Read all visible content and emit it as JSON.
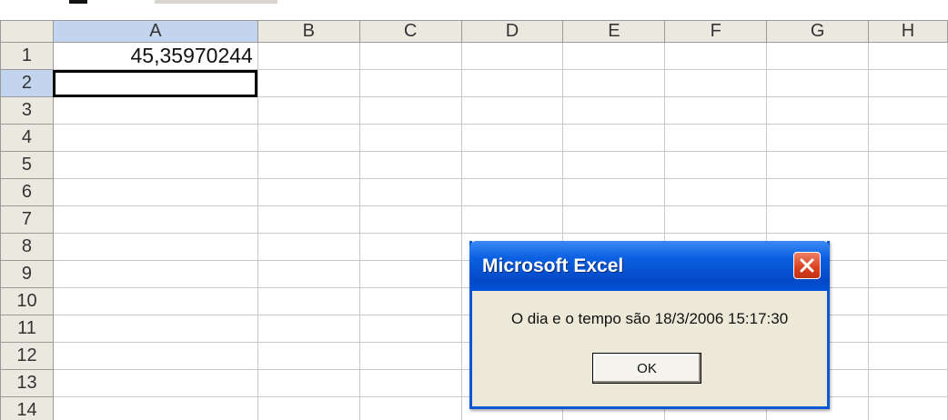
{
  "app": {
    "name": "Microsoft Excel"
  },
  "columns": [
    "A",
    "B",
    "C",
    "D",
    "E",
    "F",
    "G",
    "H"
  ],
  "rows": [
    "1",
    "2",
    "3",
    "4",
    "5",
    "6",
    "7",
    "8",
    "9",
    "10",
    "11",
    "12",
    "13",
    "14"
  ],
  "cells": {
    "A1": "45,35970244"
  },
  "selection": {
    "column": "A",
    "row": "2",
    "active_cell": "A2"
  },
  "dialog": {
    "title": "Microsoft Excel",
    "message": "O dia e o tempo são 18/3/2006 15:17:30",
    "ok_label": "OK",
    "close_icon": "close-icon"
  },
  "colors": {
    "header_bg": "#ebe9df",
    "selected_header_bg": "#c3d4ef",
    "titlebar_blue": "#0a5fe0",
    "close_red": "#d9411f",
    "dialog_bg": "#ece9d8"
  }
}
